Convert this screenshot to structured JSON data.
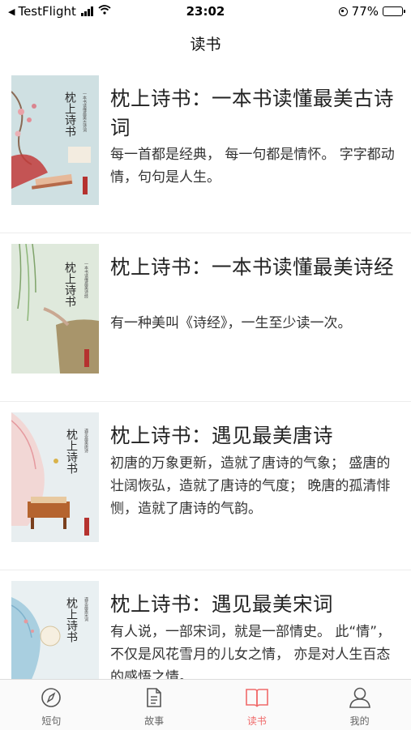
{
  "status_bar": {
    "back_app": "TestFlight",
    "time": "23:02",
    "battery": "77%",
    "battery_level": 0.77
  },
  "nav": {
    "title": "读书"
  },
  "books": [
    {
      "title": "枕上诗书：一本书读懂最美古诗词",
      "description": "每一首都是经典， 每一句都是情怀。 字字都动情，句句是人生。",
      "cover_title": "枕上诗书",
      "cover_subtitle": "一本书读懂最美古诗词"
    },
    {
      "title": "枕上诗书：一本书读懂最美诗经",
      "description": "有一种美叫《诗经》，一生至少读一次。",
      "cover_title": "枕上诗书",
      "cover_subtitle": "一本书读懂最美诗经"
    },
    {
      "title": "枕上诗书：遇见最美唐诗",
      "description": "初唐的万象更新，造就了唐诗的气象； 盛唐的壮阔恢弘，造就了唐诗的气度； 晚唐的孤清悱恻，造就了唐诗的气韵。",
      "cover_title": "枕上诗书",
      "cover_subtitle": "遇见最美唐诗"
    },
    {
      "title": "枕上诗书：遇见最美宋词",
      "description": "有人说，一部宋词，就是一部情史。 此“情”，不仅是风花雪月的儿女之情， 亦是对人生百态的感悟之情。",
      "cover_title": "枕上诗书",
      "cover_subtitle": "遇见最美宋词"
    }
  ],
  "tabs": [
    {
      "label": "短句",
      "icon": "compass-icon",
      "active": false
    },
    {
      "label": "故事",
      "icon": "document-icon",
      "active": false
    },
    {
      "label": "读书",
      "icon": "book-icon",
      "active": true
    },
    {
      "label": "我的",
      "icon": "person-icon",
      "active": false
    }
  ],
  "colors": {
    "accent": "#f06a6a",
    "tab_inactive": "#666666"
  }
}
